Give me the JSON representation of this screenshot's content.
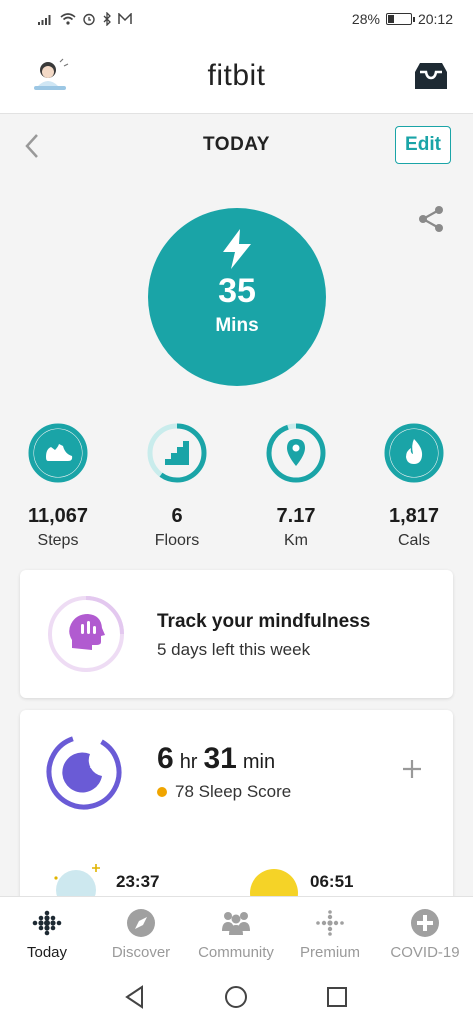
{
  "status_bar": {
    "battery_percent_text": "28%",
    "battery_level": 0.28,
    "time": "20:12",
    "icons": [
      "signal-icon",
      "wifi-icon",
      "alarm-icon",
      "bluetooth-icon",
      "mail-icon"
    ]
  },
  "header": {
    "logo": "fitbit",
    "avatar_icon": "avatar-icon",
    "inbox_icon": "inbox-icon"
  },
  "day_nav": {
    "title": "TODAY",
    "edit_label": "Edit",
    "back_icon": "chevron-left-icon",
    "share_icon": "share-icon"
  },
  "hero": {
    "value": "35",
    "unit": "Mins",
    "icon": "lightning-icon",
    "color": "#1aa4a7"
  },
  "stats": [
    {
      "value": "11,067",
      "label": "Steps",
      "icon": "shoe-icon",
      "progress": 1.0
    },
    {
      "value": "6",
      "label": "Floors",
      "icon": "stairs-icon",
      "progress": 0.6
    },
    {
      "value": "7.17",
      "label": "Km",
      "icon": "location-pin-icon",
      "progress": 0.95
    },
    {
      "value": "1,817",
      "label": "Cals",
      "icon": "flame-icon",
      "progress": 1.0
    }
  ],
  "mindfulness": {
    "title": "Track your mindfulness",
    "subtitle": "5 days left this week",
    "icon": "mind-head-icon",
    "color": "#b15bd0"
  },
  "sleep": {
    "hours": "6",
    "hours_unit": "hr",
    "minutes": "31",
    "minutes_unit": "min",
    "score_text": "78 Sleep Score",
    "bed_time": "23:37",
    "wake_time": "06:51",
    "color": "#6a5bd6",
    "score_color": "#f0a500"
  },
  "bottom_nav": [
    {
      "label": "Today",
      "icon": "dots-grid-icon",
      "active": true
    },
    {
      "label": "Discover",
      "icon": "compass-icon",
      "active": false
    },
    {
      "label": "Community",
      "icon": "people-icon",
      "active": false
    },
    {
      "label": "Premium",
      "icon": "premium-dots-icon",
      "active": false
    },
    {
      "label": "COVID-19",
      "icon": "plus-circle-icon",
      "active": false
    }
  ],
  "system_nav": [
    "back-triangle-icon",
    "home-circle-icon",
    "recents-square-icon"
  ]
}
